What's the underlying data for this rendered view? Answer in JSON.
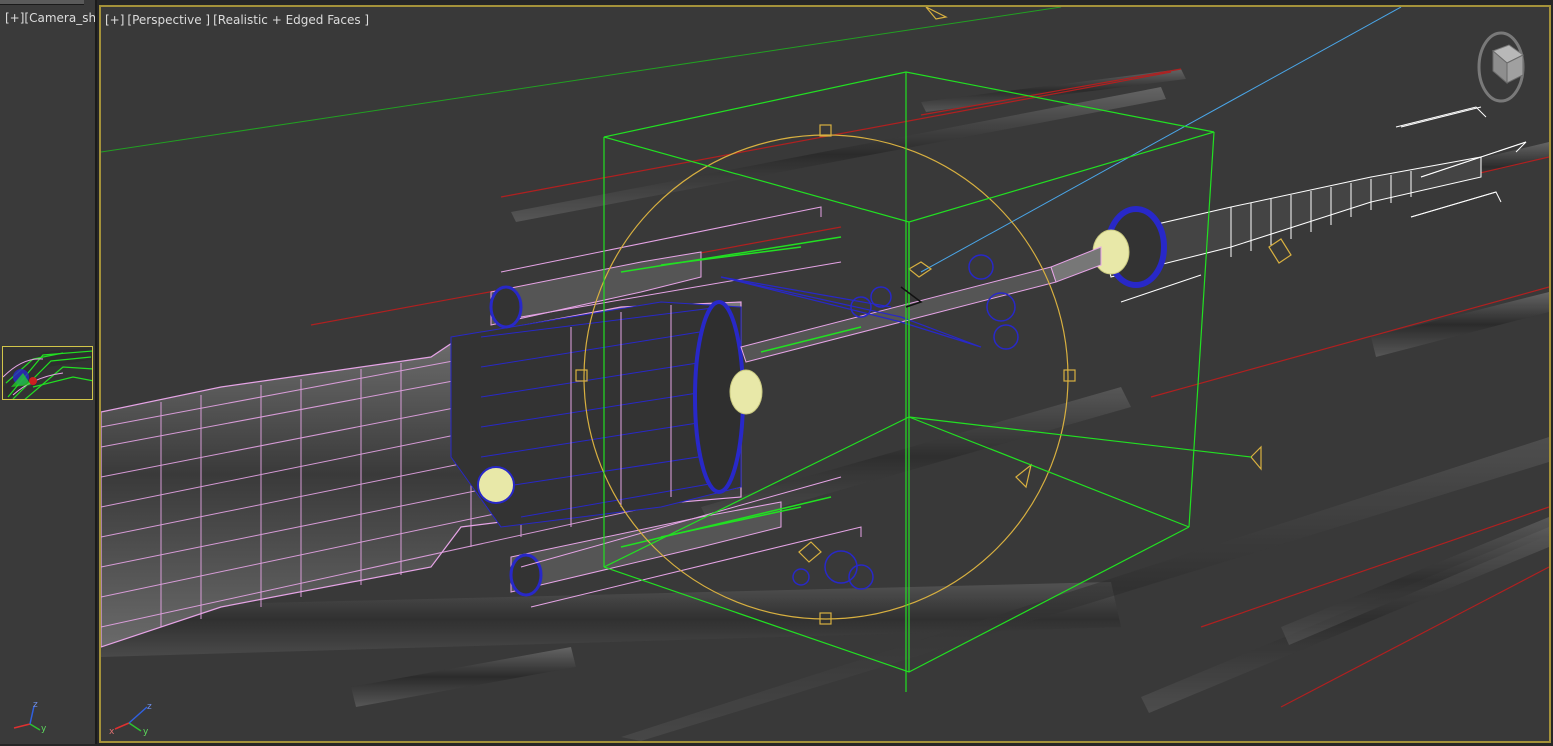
{
  "left_viewport": {
    "plus": "[+]",
    "view": "[Camera_sho"
  },
  "main_viewport": {
    "plus": "[+]",
    "view": "[Perspective ]",
    "shading": "[Realistic + Edged Faces ]"
  },
  "axis_gizmo": {
    "x": "x",
    "y": "y",
    "z": "z"
  },
  "colors": {
    "viewport_bg": "#393939",
    "active_border": "#a4923a",
    "selection_green": "#22e022",
    "mesh_pink": "#e6a4e6",
    "mesh_blue": "#2828c8",
    "gizmo_yellow": "#d8b040",
    "guide_red": "#b02020"
  },
  "icons": [
    "viewcube-icon",
    "axis-tripod-icon",
    "camera-icon",
    "light-icon",
    "helper-icon"
  ]
}
